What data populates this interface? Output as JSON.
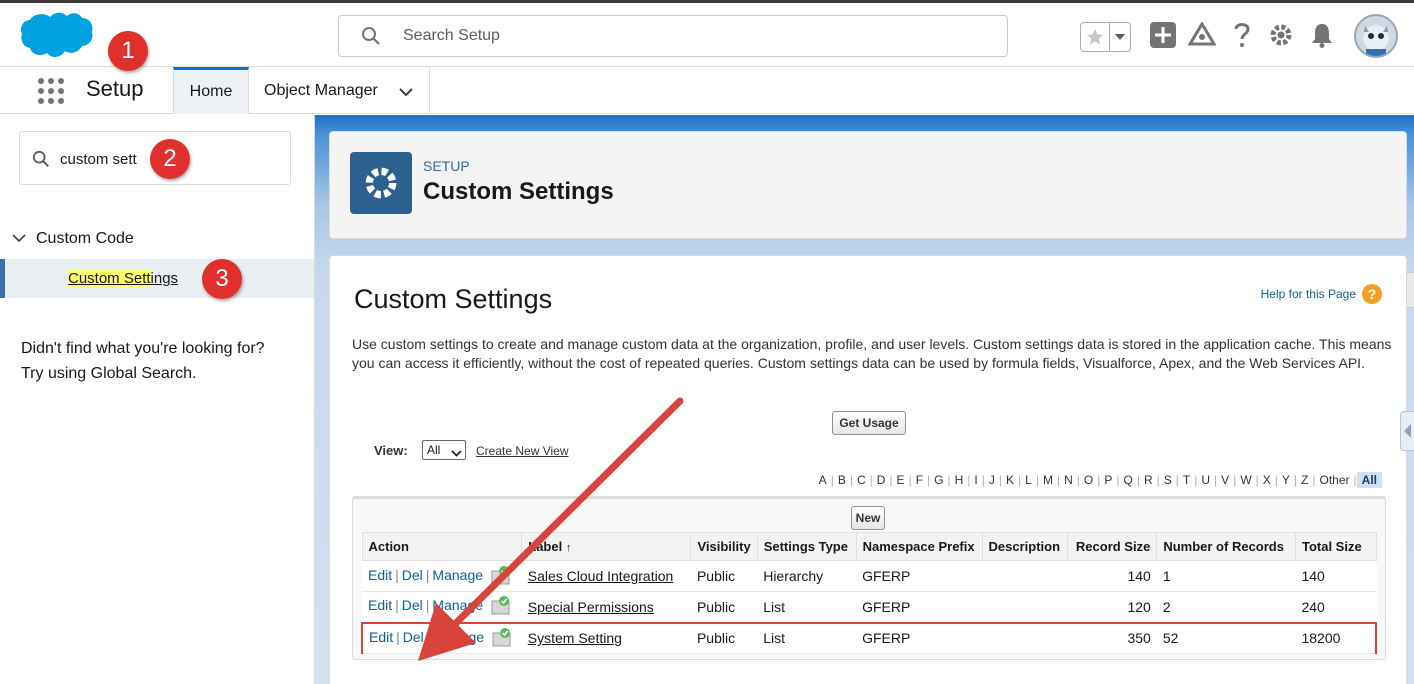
{
  "header": {
    "search_placeholder": "Search Setup"
  },
  "context": {
    "app_name": "Setup",
    "tabs": [
      {
        "label": "Home"
      },
      {
        "label": "Object Manager"
      }
    ]
  },
  "annotations": {
    "badge1": "1",
    "badge2": "2",
    "badge3": "3"
  },
  "sidebar": {
    "quick_find_value": "custom sett",
    "tree_parent": "Custom Code",
    "tree_child_highlight": "Custom Sett",
    "tree_child_rest": "ings",
    "not_found_line1": "Didn't find what you're looking for?",
    "not_found_line2": "Try using Global Search."
  },
  "page_header": {
    "eyebrow": "SETUP",
    "title": "Custom Settings"
  },
  "content": {
    "heading": "Custom Settings",
    "help_link": "Help for this Page",
    "description": "Use custom settings to create and manage custom data at the organization, profile, and user levels. Custom settings data is stored in the application cache. This means you can access it efficiently, without the cost of repeated queries. Custom settings data can be used by formula fields, Visualforce, Apex, and the Web Services API.",
    "get_usage_button": "Get Usage",
    "view_label": "View:",
    "view_selected": "All",
    "create_view_link": "Create New View",
    "alpha": [
      "A",
      "B",
      "C",
      "D",
      "E",
      "F",
      "G",
      "H",
      "I",
      "J",
      "K",
      "L",
      "M",
      "N",
      "O",
      "P",
      "Q",
      "R",
      "S",
      "T",
      "U",
      "V",
      "W",
      "X",
      "Y",
      "Z",
      "Other"
    ],
    "alpha_active": "All",
    "new_button": "New"
  },
  "table": {
    "headers": {
      "action": "Action",
      "label": "Label",
      "sort_indicator": "↑",
      "visibility": "Visibility",
      "settings_type": "Settings Type",
      "namespace_prefix": "Namespace Prefix",
      "description": "Description",
      "record_size": "Record Size",
      "number_of_records": "Number of Records",
      "total_size": "Total Size"
    },
    "action_links": {
      "edit": "Edit",
      "del": "Del",
      "manage": "Manage"
    },
    "rows": [
      {
        "label": "Sales Cloud Integration",
        "visibility": "Public",
        "settings_type": "Hierarchy",
        "namespace_prefix": "GFERP",
        "description": "",
        "record_size": "140",
        "number_of_records": "1",
        "total_size": "140"
      },
      {
        "label": "Special Permissions",
        "visibility": "Public",
        "settings_type": "List",
        "namespace_prefix": "GFERP",
        "description": "",
        "record_size": "120",
        "number_of_records": "2",
        "total_size": "240"
      },
      {
        "label": "System Setting",
        "visibility": "Public",
        "settings_type": "List",
        "namespace_prefix": "GFERP",
        "description": "",
        "record_size": "350",
        "number_of_records": "52",
        "total_size": "18200"
      }
    ]
  },
  "colors": {
    "brand_blue": "#00a1e0",
    "link_blue": "#0f5e9c",
    "badge_red": "#e0302d",
    "highlight_yellow": "#ffff70"
  }
}
